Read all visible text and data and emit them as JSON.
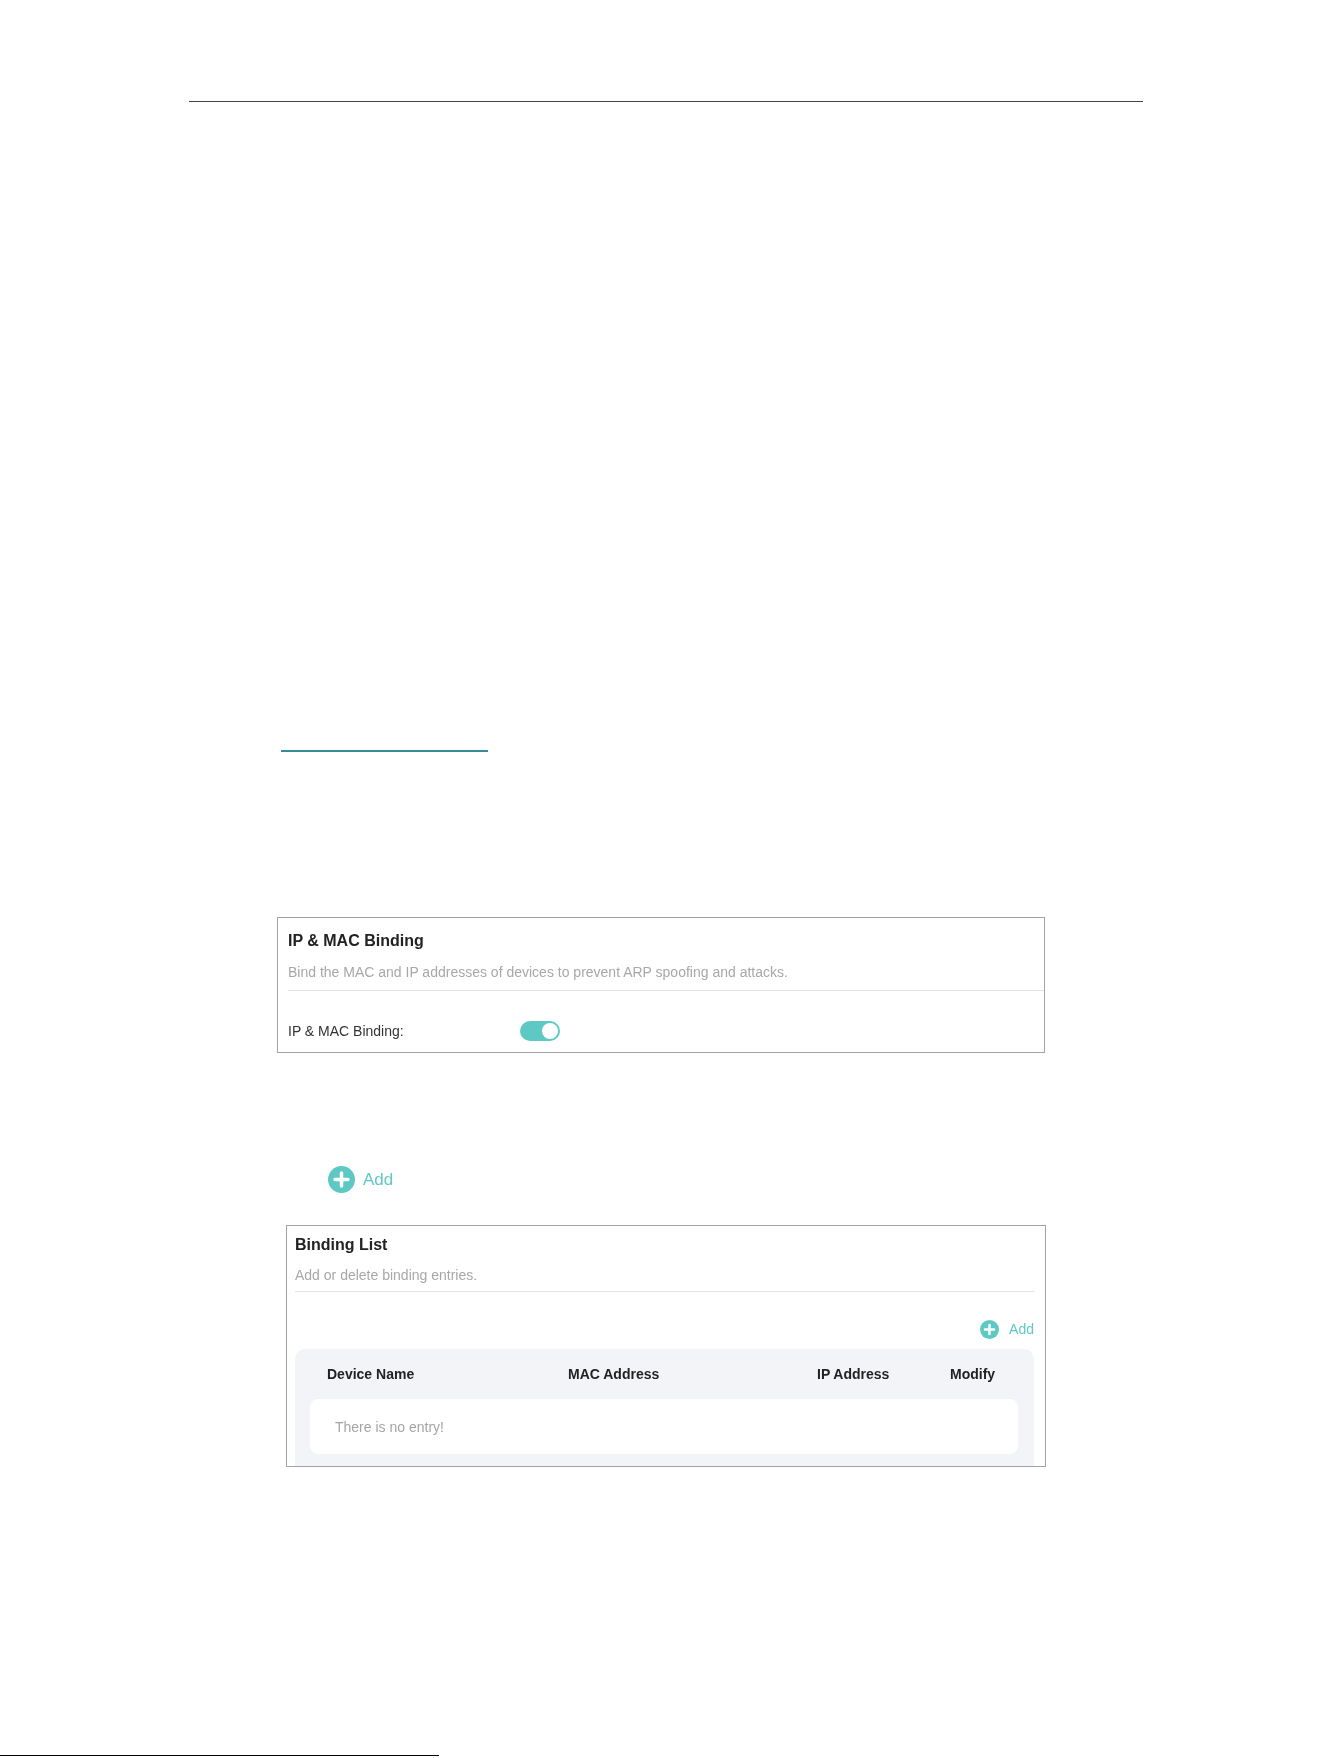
{
  "ip_mac_binding_panel": {
    "title": "IP & MAC Binding",
    "description": "Bind the MAC and IP addresses of devices to prevent ARP spoofing and attacks.",
    "fields": [
      {
        "kind": "toggle",
        "label": "IP & MAC Binding:",
        "on": true
      }
    ]
  },
  "add_button": {
    "label": "Add"
  },
  "binding_list_panel": {
    "title": "Binding List",
    "description": "Add or delete binding entries.",
    "add_button": {
      "label": "Add"
    },
    "table": {
      "columns": [
        "Device Name",
        "MAC Address",
        "IP Address",
        "Modify"
      ],
      "empty_message": "There is no entry!"
    }
  }
}
